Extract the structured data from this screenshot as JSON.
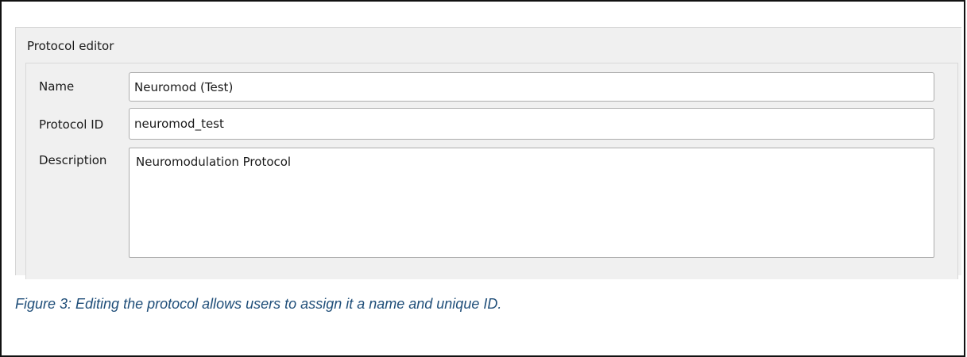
{
  "editor": {
    "title": "Protocol editor",
    "fields": {
      "name": {
        "label": "Name",
        "value": "Neuromod (Test)"
      },
      "protocol_id": {
        "label": "Protocol ID",
        "value": "neuromod_test"
      },
      "description": {
        "label": "Description",
        "value": "Neuromodulation Protocol"
      }
    }
  },
  "caption": "Figure 3: Editing the protocol allows users to assign it a name and unique ID.",
  "colors": {
    "caption_text": "#1f4e79",
    "panel_background": "#f0f0f0",
    "field_border": "#adadad"
  }
}
